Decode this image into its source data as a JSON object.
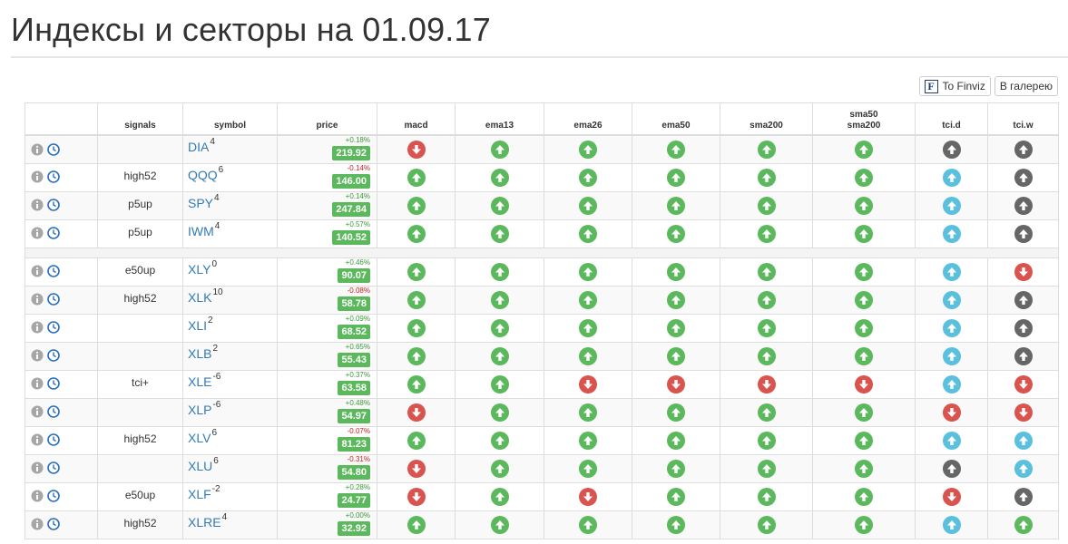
{
  "page": {
    "title": "Индексы и секторы на 01.09.17"
  },
  "toolbar": {
    "finviz_icon_letter": "F",
    "finviz_label": "To Finviz",
    "gallery_label": "В галерею"
  },
  "columns": {
    "signals": "signals",
    "symbol": "symbol",
    "price": "price",
    "macd": "macd",
    "ema13": "ema13",
    "ema26": "ema26",
    "ema50": "ema50",
    "sma200": "sma200",
    "sma50_line1": "sma50",
    "sma50_line2": "sma200",
    "tcid": "tci.d",
    "tciw": "tci.w"
  },
  "colors": {
    "up": "#5cb85c",
    "down": "#d9534f",
    "info": "#5bc0de",
    "neutral": "#666666",
    "link": "#337ab7"
  },
  "groups": [
    [
      {
        "signal": "",
        "symbol": "DIA",
        "rank": "4",
        "change": "+0.18%",
        "dir": "up",
        "price": "219.92",
        "ind": [
          "down",
          "up",
          "up",
          "up",
          "up",
          "up",
          "neutral",
          "neutral"
        ]
      },
      {
        "signal": "high52",
        "symbol": "QQQ",
        "rank": "6",
        "change": "-0.14%",
        "dir": "down",
        "price": "146.00",
        "ind": [
          "up",
          "up",
          "up",
          "up",
          "up",
          "up",
          "info",
          "neutral"
        ]
      },
      {
        "signal": "p5up",
        "symbol": "SPY",
        "rank": "4",
        "change": "+0.14%",
        "dir": "up",
        "price": "247.84",
        "ind": [
          "up",
          "up",
          "up",
          "up",
          "up",
          "up",
          "info",
          "neutral"
        ]
      },
      {
        "signal": "p5up",
        "symbol": "IWM",
        "rank": "4",
        "change": "+0.57%",
        "dir": "up",
        "price": "140.52",
        "ind": [
          "up",
          "up",
          "up",
          "up",
          "up",
          "up",
          "info",
          "neutral"
        ]
      }
    ],
    [
      {
        "signal": "e50up",
        "symbol": "XLY",
        "rank": "0",
        "change": "+0.46%",
        "dir": "up",
        "price": "90.07",
        "ind": [
          "up",
          "up",
          "up",
          "up",
          "up",
          "up",
          "info",
          "down"
        ]
      },
      {
        "signal": "high52",
        "symbol": "XLK",
        "rank": "10",
        "change": "-0.08%",
        "dir": "down",
        "price": "58.78",
        "ind": [
          "up",
          "up",
          "up",
          "up",
          "up",
          "up",
          "info",
          "neutral"
        ]
      },
      {
        "signal": "",
        "symbol": "XLI",
        "rank": "2",
        "change": "+0.09%",
        "dir": "up",
        "price": "68.52",
        "ind": [
          "up",
          "up",
          "up",
          "up",
          "up",
          "up",
          "info",
          "neutral"
        ]
      },
      {
        "signal": "",
        "symbol": "XLB",
        "rank": "2",
        "change": "+0.65%",
        "dir": "up",
        "price": "55.43",
        "ind": [
          "up",
          "up",
          "up",
          "up",
          "up",
          "up",
          "info",
          "neutral"
        ]
      },
      {
        "signal": "tci+",
        "symbol": "XLE",
        "rank": "-6",
        "change": "+0.37%",
        "dir": "up",
        "price": "63.58",
        "ind": [
          "up",
          "up",
          "down",
          "down",
          "down",
          "down",
          "info",
          "down"
        ]
      },
      {
        "signal": "",
        "symbol": "XLP",
        "rank": "-6",
        "change": "+0.48%",
        "dir": "up",
        "price": "54.97",
        "ind": [
          "down",
          "up",
          "up",
          "up",
          "up",
          "up",
          "down",
          "down"
        ]
      },
      {
        "signal": "high52",
        "symbol": "XLV",
        "rank": "6",
        "change": "-0.07%",
        "dir": "down",
        "price": "81.23",
        "ind": [
          "up",
          "up",
          "up",
          "up",
          "up",
          "up",
          "info",
          "info"
        ]
      },
      {
        "signal": "",
        "symbol": "XLU",
        "rank": "6",
        "change": "-0.31%",
        "dir": "down",
        "price": "54.80",
        "ind": [
          "down",
          "up",
          "up",
          "up",
          "up",
          "up",
          "neutral",
          "info"
        ]
      },
      {
        "signal": "e50up",
        "symbol": "XLF",
        "rank": "-2",
        "change": "+0.28%",
        "dir": "up",
        "price": "24.77",
        "ind": [
          "down",
          "up",
          "down",
          "up",
          "up",
          "up",
          "down",
          "neutral"
        ]
      },
      {
        "signal": "high52",
        "symbol": "XLRE",
        "rank": "4",
        "change": "+0.00%",
        "dir": "up",
        "price": "32.92",
        "ind": [
          "up",
          "up",
          "up",
          "up",
          "up",
          "up",
          "info",
          "up"
        ]
      }
    ]
  ]
}
